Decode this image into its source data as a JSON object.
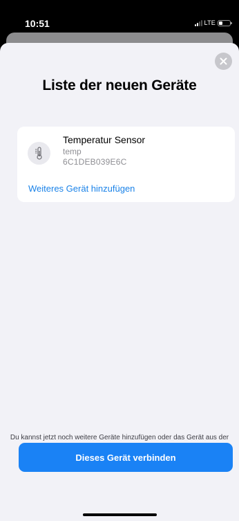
{
  "status_bar": {
    "time": "10:51",
    "network": "LTE",
    "battery_level": 0.3
  },
  "sheet": {
    "title": "Liste der neuen Geräte",
    "close_icon": "close-x-icon"
  },
  "devices": [
    {
      "name": "Temperatur Sensor",
      "type": "temp",
      "id": "6C1DEB039E6C",
      "icon": "thermometer-icon"
    }
  ],
  "add_device_link": "Weiteres Gerät hinzufügen",
  "hint_text": "Du kannst jetzt noch weitere Geräte hinzufügen oder das Gerät aus der oberen Liste mit dem Relay verbinden.",
  "primary_button": "Dieses Gerät verbinden",
  "colors": {
    "accent": "#1a82f5",
    "link": "#1a82e8",
    "background": "#f2f2f7"
  }
}
